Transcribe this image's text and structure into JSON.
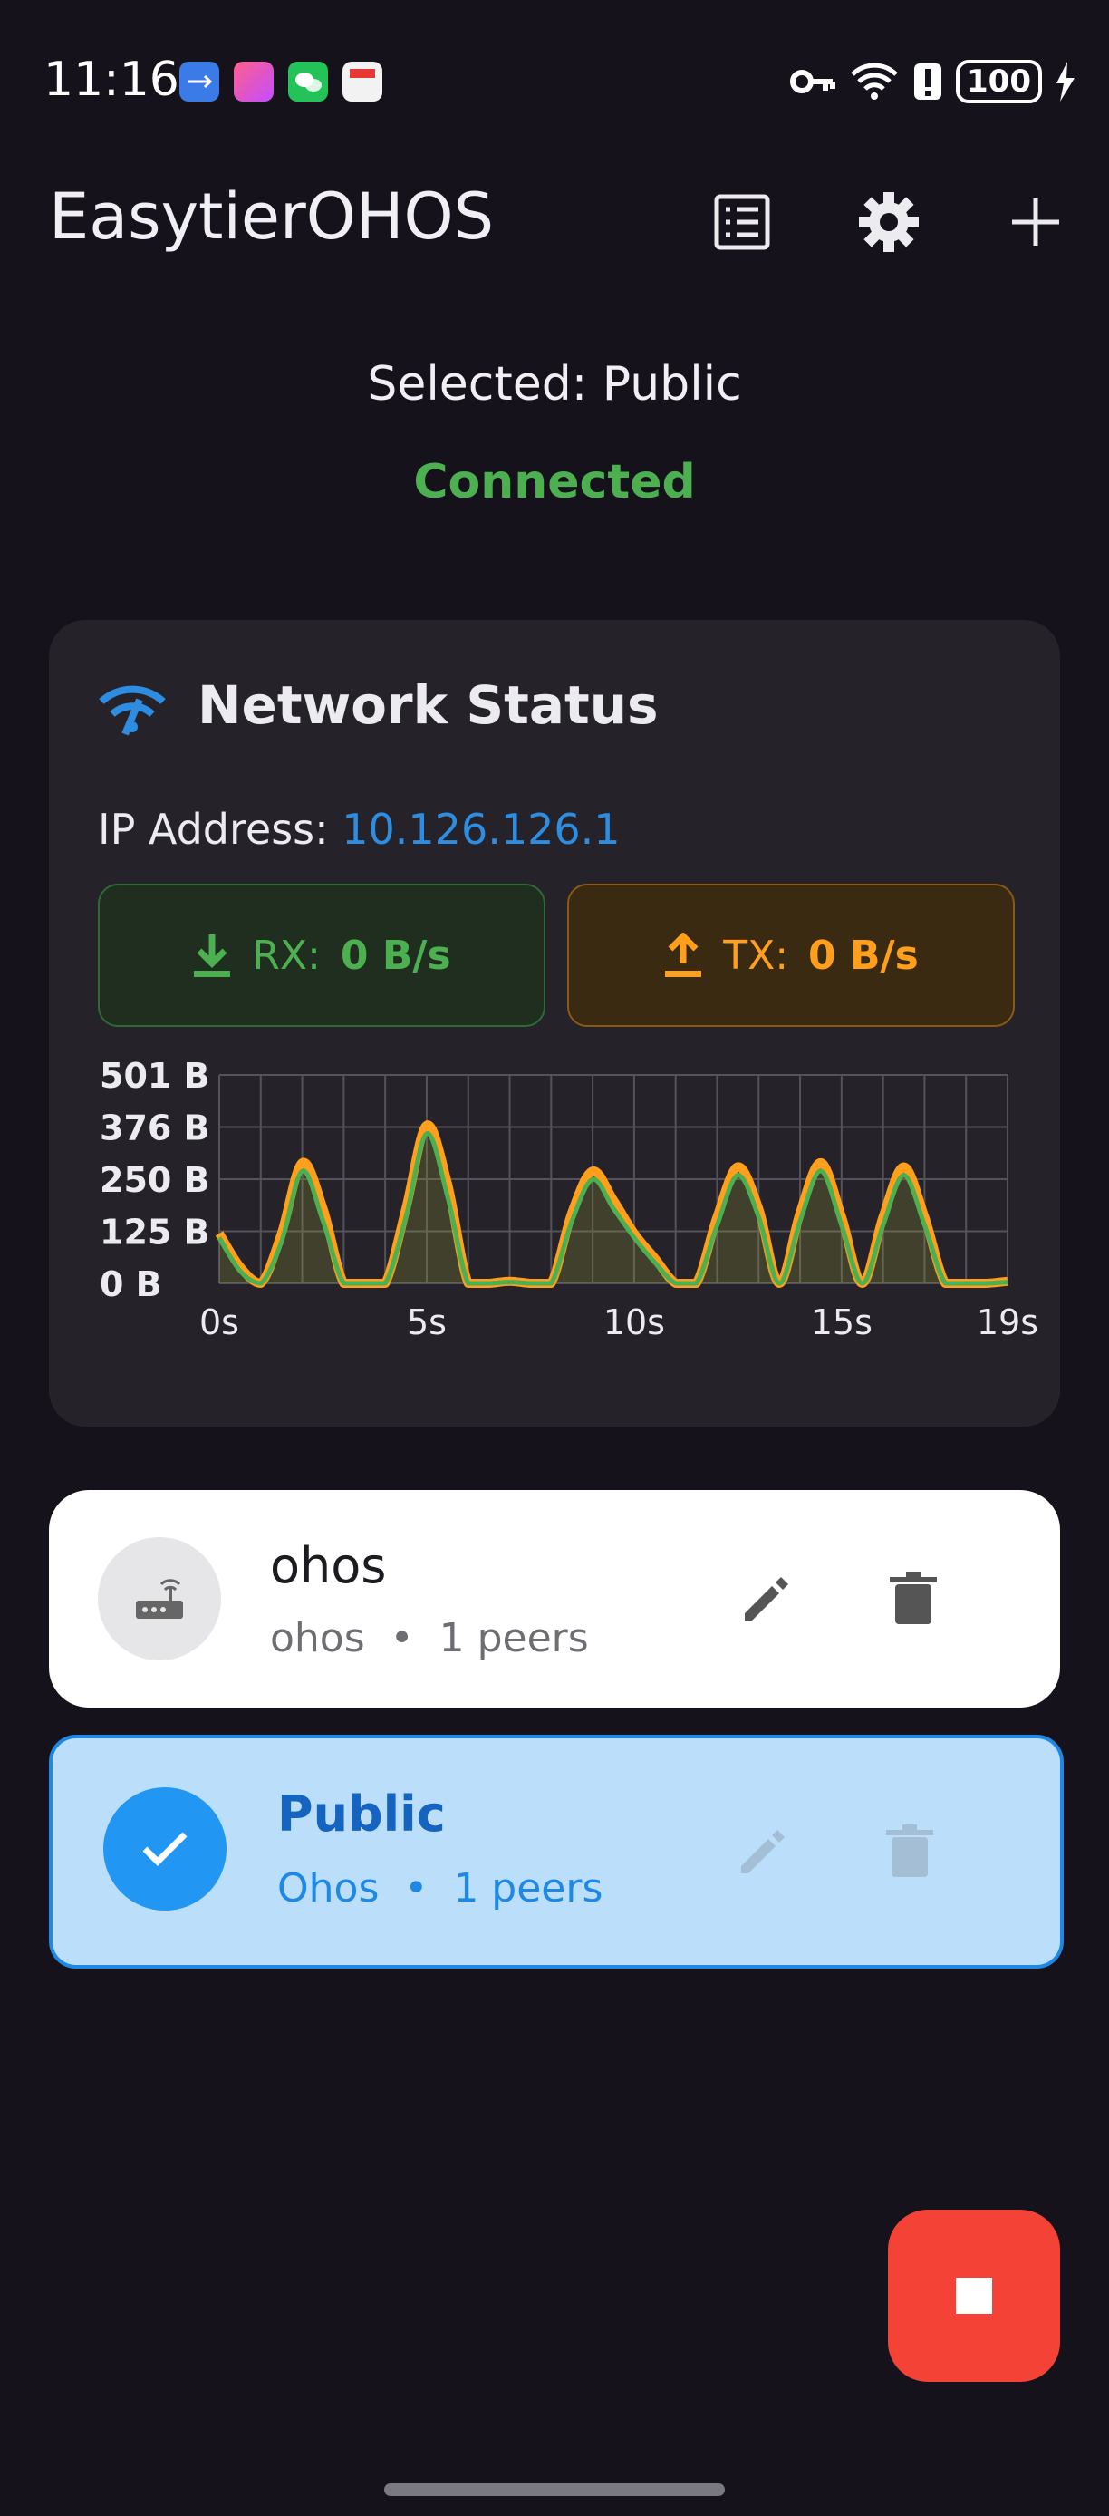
{
  "status_bar": {
    "time": "11:16",
    "battery": "100",
    "icons": [
      "usb-icon",
      "app-icon",
      "wechat-icon",
      "notes-icon",
      "key-icon",
      "wifi-icon",
      "alert-icon",
      "battery-icon",
      "charging-icon"
    ]
  },
  "app_bar": {
    "title": "EasytierOHOS",
    "actions": [
      "list-icon",
      "gear-icon",
      "plus-icon"
    ]
  },
  "selection": {
    "selected_text": "Selected: Public",
    "status": "Connected",
    "status_color": "#4caf50"
  },
  "network_status": {
    "title": "Network Status",
    "ip_label": "IP Address:",
    "ip_value": "10.126.126.1",
    "rx_label": "RX:",
    "rx_value": "0 B/s",
    "tx_label": "TX:",
    "tx_value": "0 B/s"
  },
  "chart_data": {
    "type": "area",
    "x": [
      0,
      0.5,
      1,
      1.5,
      2,
      2.5,
      3,
      3.5,
      4,
      4.5,
      5,
      5.5,
      6,
      6.5,
      7,
      7.5,
      8,
      8.5,
      9,
      9.5,
      10,
      10.5,
      11,
      11.5,
      12,
      12.5,
      13,
      13.5,
      14,
      14.5,
      15,
      15.5,
      16,
      16.5,
      17,
      17.5,
      18,
      18.5,
      19
    ],
    "x_ticks": [
      "0s",
      "5s",
      "10s",
      "15s",
      "19s"
    ],
    "y_ticks": [
      "0 B",
      "125 B",
      "250 B",
      "376 B",
      "501 B"
    ],
    "ylim": [
      0,
      501
    ],
    "series": [
      {
        "color": "#ff9f1c",
        "values": [
          120,
          40,
          0,
          120,
          290,
          180,
          0,
          0,
          0,
          180,
          380,
          240,
          0,
          0,
          5,
          0,
          0,
          170,
          270,
          200,
          120,
          60,
          0,
          0,
          160,
          280,
          180,
          0,
          170,
          290,
          160,
          0,
          160,
          280,
          160,
          0,
          0,
          0,
          5
        ]
      },
      {
        "color": "#4caf50",
        "values": [
          110,
          30,
          0,
          100,
          270,
          150,
          0,
          0,
          0,
          160,
          360,
          210,
          0,
          0,
          3,
          0,
          0,
          150,
          250,
          180,
          110,
          50,
          0,
          0,
          140,
          260,
          160,
          0,
          150,
          270,
          140,
          0,
          140,
          260,
          140,
          0,
          0,
          0,
          3
        ]
      }
    ]
  },
  "profiles": [
    {
      "name": "ohos",
      "sub_name": "ohos",
      "peers": "1 peers",
      "selected": false
    },
    {
      "name": "Public",
      "sub_name": "Ohos",
      "peers": "1 peers",
      "selected": true
    }
  ],
  "fab": {
    "icon": "stop-icon",
    "color": "#f44336"
  }
}
